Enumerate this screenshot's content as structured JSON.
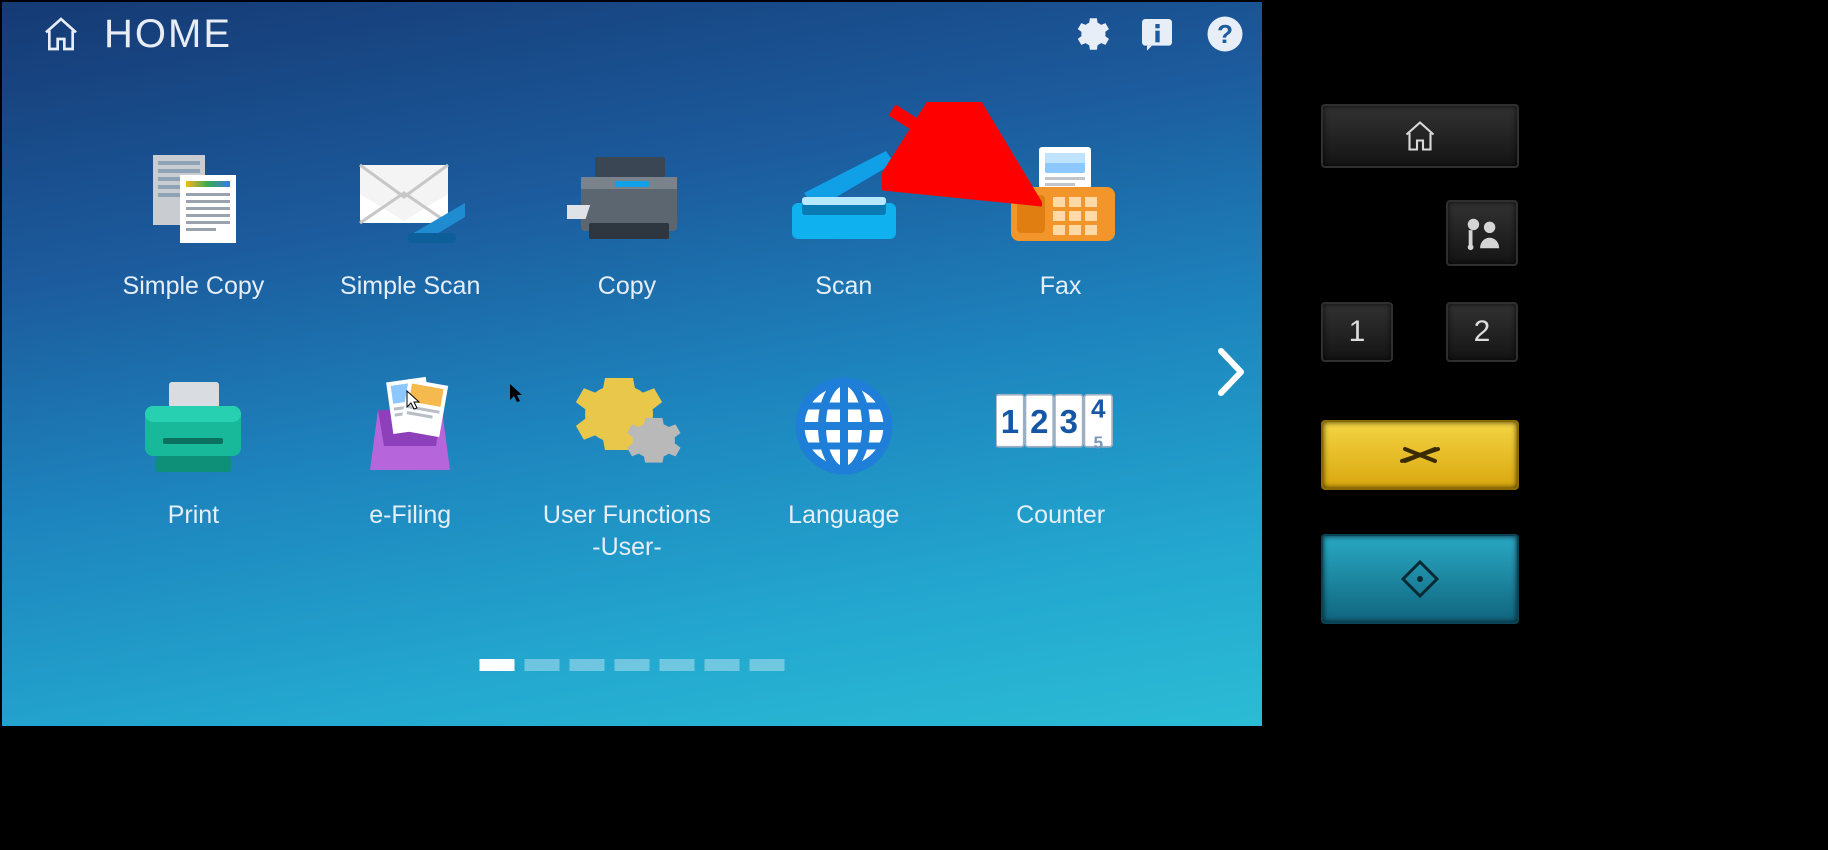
{
  "header": {
    "title": "HOME"
  },
  "apps": [
    {
      "id": "simple-copy",
      "label": "Simple Copy"
    },
    {
      "id": "simple-scan",
      "label": "Simple Scan"
    },
    {
      "id": "copy",
      "label": "Copy"
    },
    {
      "id": "scan",
      "label": "Scan"
    },
    {
      "id": "fax",
      "label": "Fax"
    },
    {
      "id": "print",
      "label": "Print"
    },
    {
      "id": "e-filing",
      "label": "e-Filing"
    },
    {
      "id": "user-functions",
      "label": "User Functions\n-User-"
    },
    {
      "id": "language",
      "label": "Language"
    },
    {
      "id": "counter",
      "label": "Counter"
    }
  ],
  "pager": {
    "total": 7,
    "active": 0
  },
  "panel": {
    "key1": "1",
    "key2": "2"
  },
  "counter_digits": [
    "1",
    "2",
    "3",
    "4",
    "5"
  ],
  "annotation": {
    "arrow_points_to": "fax"
  }
}
